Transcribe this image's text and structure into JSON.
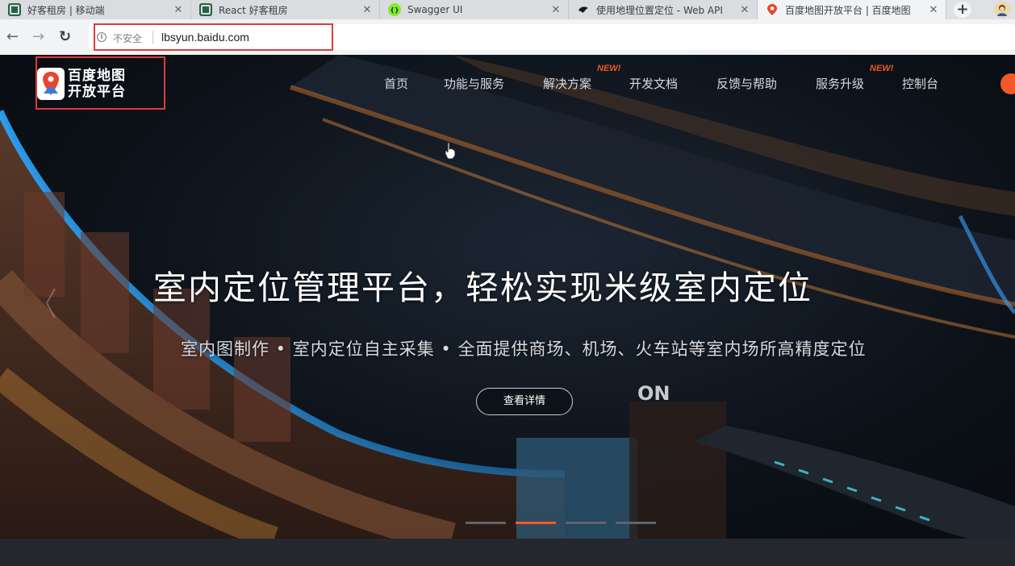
{
  "browser": {
    "tabs": [
      {
        "title": "好客租房 | 移动端",
        "icon": "app-icon"
      },
      {
        "title": "React 好客租房",
        "icon": "app-icon"
      },
      {
        "title": "Swagger UI",
        "icon": "swagger-icon"
      },
      {
        "title": "使用地理位置定位 - Web API",
        "icon": "bird-icon"
      },
      {
        "title": "百度地图开放平台 | 百度地图",
        "icon": "baidu-map-icon"
      }
    ],
    "new_tab": "+",
    "close_glyph": "✕",
    "security_text": "不安全",
    "url": "lbsyun.baidu.com"
  },
  "site": {
    "logo_line1": "百度地图",
    "logo_line2": "开放平台",
    "nav": [
      "首页",
      "功能与服务",
      "解决方案",
      "开发文档",
      "反馈与帮助",
      "服务升级",
      "控制台"
    ],
    "new_badge": "NEW!",
    "hero": {
      "headline": "室内定位管理平台，轻松实现米级室内定位",
      "subline": "室内图制作 • 室内定位自主采集 • 全面提供商场、机场、火车站等室内场所高精度定位",
      "button": "查看详情"
    },
    "carousel": {
      "count": 4,
      "active_index": 1
    }
  }
}
